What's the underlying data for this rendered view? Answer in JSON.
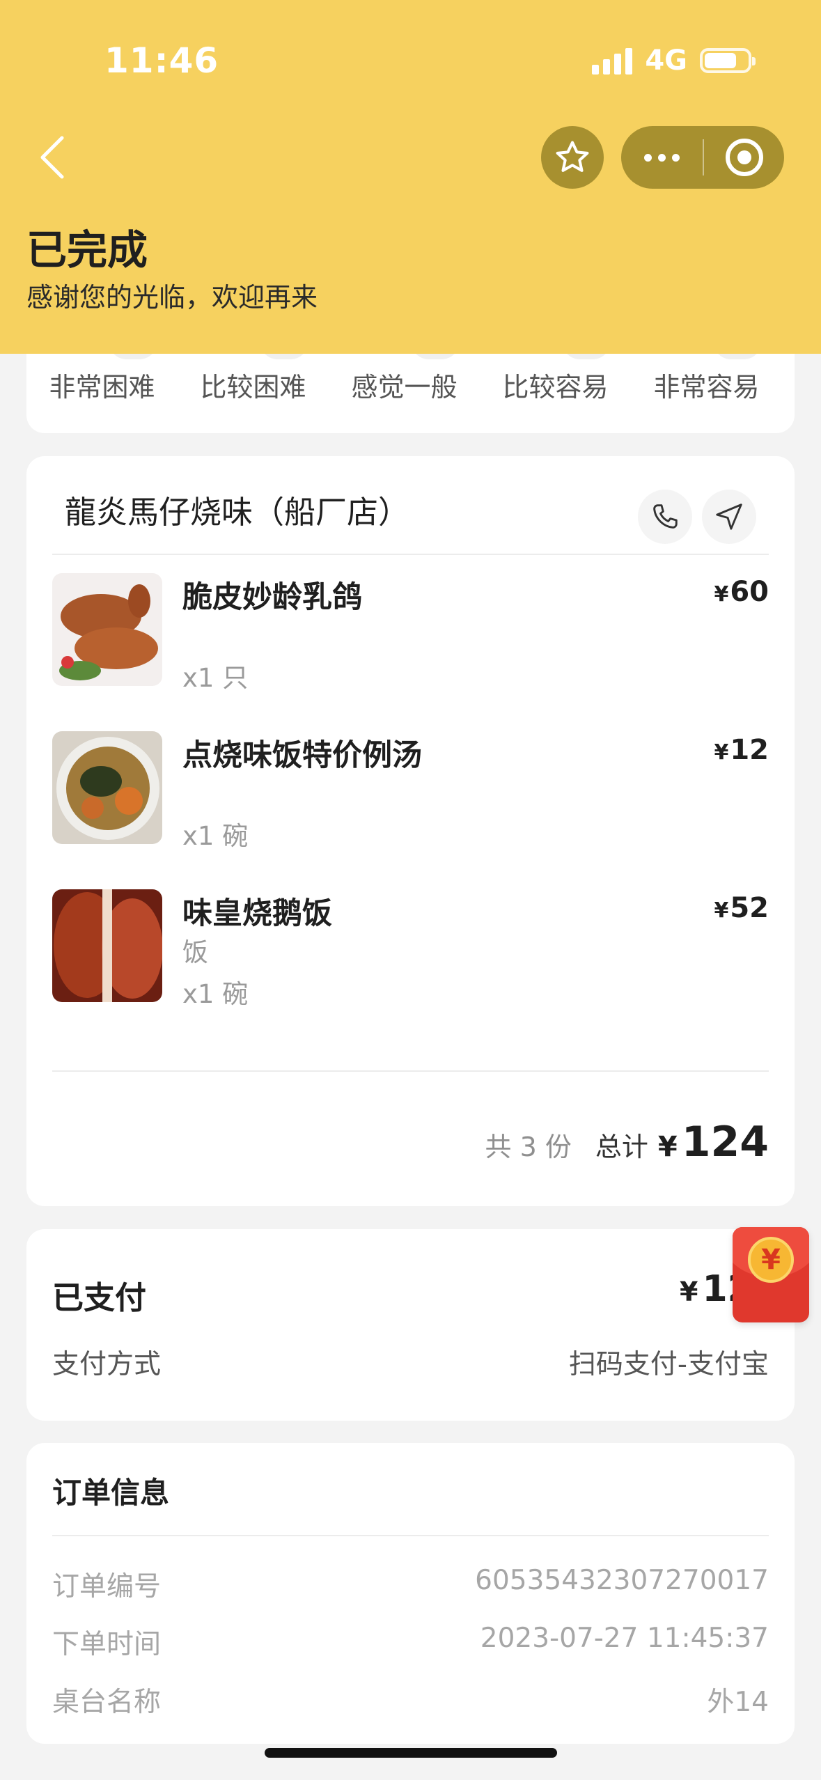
{
  "status_bar": {
    "time": "11:46",
    "network": "4G",
    "battery_level": 0.75
  },
  "header": {
    "title": "已完成",
    "subtitle": "感谢您的光临，欢迎再来"
  },
  "rating": {
    "options": [
      "非常困难",
      "比较困难",
      "感觉一般",
      "比较容易",
      "非常容易"
    ]
  },
  "store": {
    "name": "龍炎馬仔烧味（船厂店）"
  },
  "items": [
    {
      "name": "脆皮妙龄乳鸽",
      "spec": "",
      "qty": "x1 只",
      "currency": "¥",
      "price": "60"
    },
    {
      "name": "点烧味饭特价例汤",
      "spec": "",
      "qty": "x1 碗",
      "currency": "¥",
      "price": "12"
    },
    {
      "name": "味皇烧鹅饭",
      "spec": "饭",
      "qty": "x1 碗",
      "currency": "¥",
      "price": "52"
    }
  ],
  "summary": {
    "count": "共 3 份",
    "total_label": "总计",
    "currency": "¥",
    "total": "124"
  },
  "payment": {
    "status": "已支付",
    "currency": "¥",
    "amount_visible": "12",
    "method_label": "支付方式",
    "method_value": "扫码支付-支付宝"
  },
  "order_info": {
    "title": "订单信息",
    "rows": [
      {
        "key": "订单编号",
        "value": "60535432307270017"
      },
      {
        "key": "下单时间",
        "value": "2023-07-27 11:45:37"
      },
      {
        "key": "桌台名称",
        "value": "外14"
      }
    ]
  },
  "red_packet": {
    "symbol": "¥"
  },
  "icons": {
    "back": "chevron-left-icon",
    "favorite": "star-icon",
    "more": "more-icon",
    "close": "close-target-icon",
    "phone": "phone-icon",
    "navigate": "navigation-icon"
  },
  "colors": {
    "header_bg": "#f6d15f",
    "capsule_bg": "#a7902f",
    "red_packet": "#e0382d"
  }
}
